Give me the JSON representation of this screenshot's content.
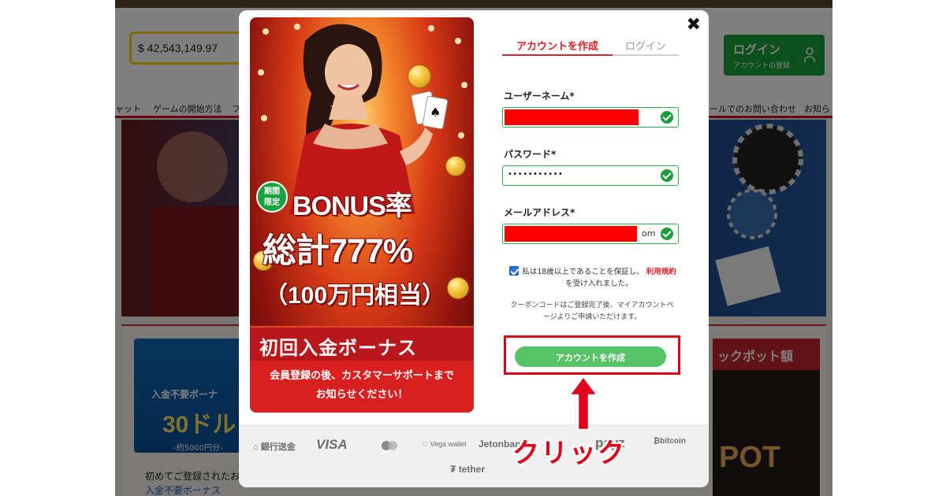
{
  "site": {
    "jackpot_amount": "$ 42,543,149.97",
    "login_button_title": "ログイン",
    "login_button_sub": "アカウントの登録",
    "nav_items": [
      "ャット",
      "ゲームの開始方法",
      "フ",
      "ールでのお問い合わせ",
      "お知ら"
    ],
    "promo_left_title": "入金不要ボーナ",
    "promo_left_amount": "30ドル",
    "promo_left_sub": "-約5000円分-",
    "lower_text_1": "初めてご登録されたお",
    "lower_text_2": "入金不要ボーナス",
    "jackpot_panel_title": "ックポット額",
    "jackpot_panel_word": "POT"
  },
  "modal": {
    "close_label": "✖",
    "promo": {
      "badge": "期間\n限定",
      "line1": "BONUS率",
      "line2": "総計777%",
      "line3": "（100万円相当）",
      "bar": "初回入金ボーナス",
      "footer_line1": "会員登録の後、カスタマーサポートまで",
      "footer_line2": "お知らせください！"
    },
    "tabs": {
      "create": "アカウントを作成",
      "login": "ログイン"
    },
    "form": {
      "username_label": "ユーザーネーム*",
      "password_label": "パスワード*",
      "password_value": "•••••••••••",
      "email_label": "メールアドレス*",
      "email_tail": "om",
      "terms_before": "私は18歳以上であることを保証し、",
      "terms_link": "利用規約",
      "terms_after": "を受け入れました。",
      "coupon_note": "クーポンコードはご登録完了後、マイアカウントページよりご申請いただけます。",
      "create_button": "アカウントを作成",
      "age_checked": true
    },
    "payments": [
      "銀行送金",
      "VISA",
      "Vega wallet",
      "Jetonbank",
      "payz",
      "bitcoin",
      "tether"
    ]
  },
  "annotation": {
    "click_label": "クリック"
  },
  "colors": {
    "accent_red": "#d8232a",
    "valid_green": "#2ab34a",
    "button_green": "#57c366",
    "annotation_red": "#e0001a"
  }
}
